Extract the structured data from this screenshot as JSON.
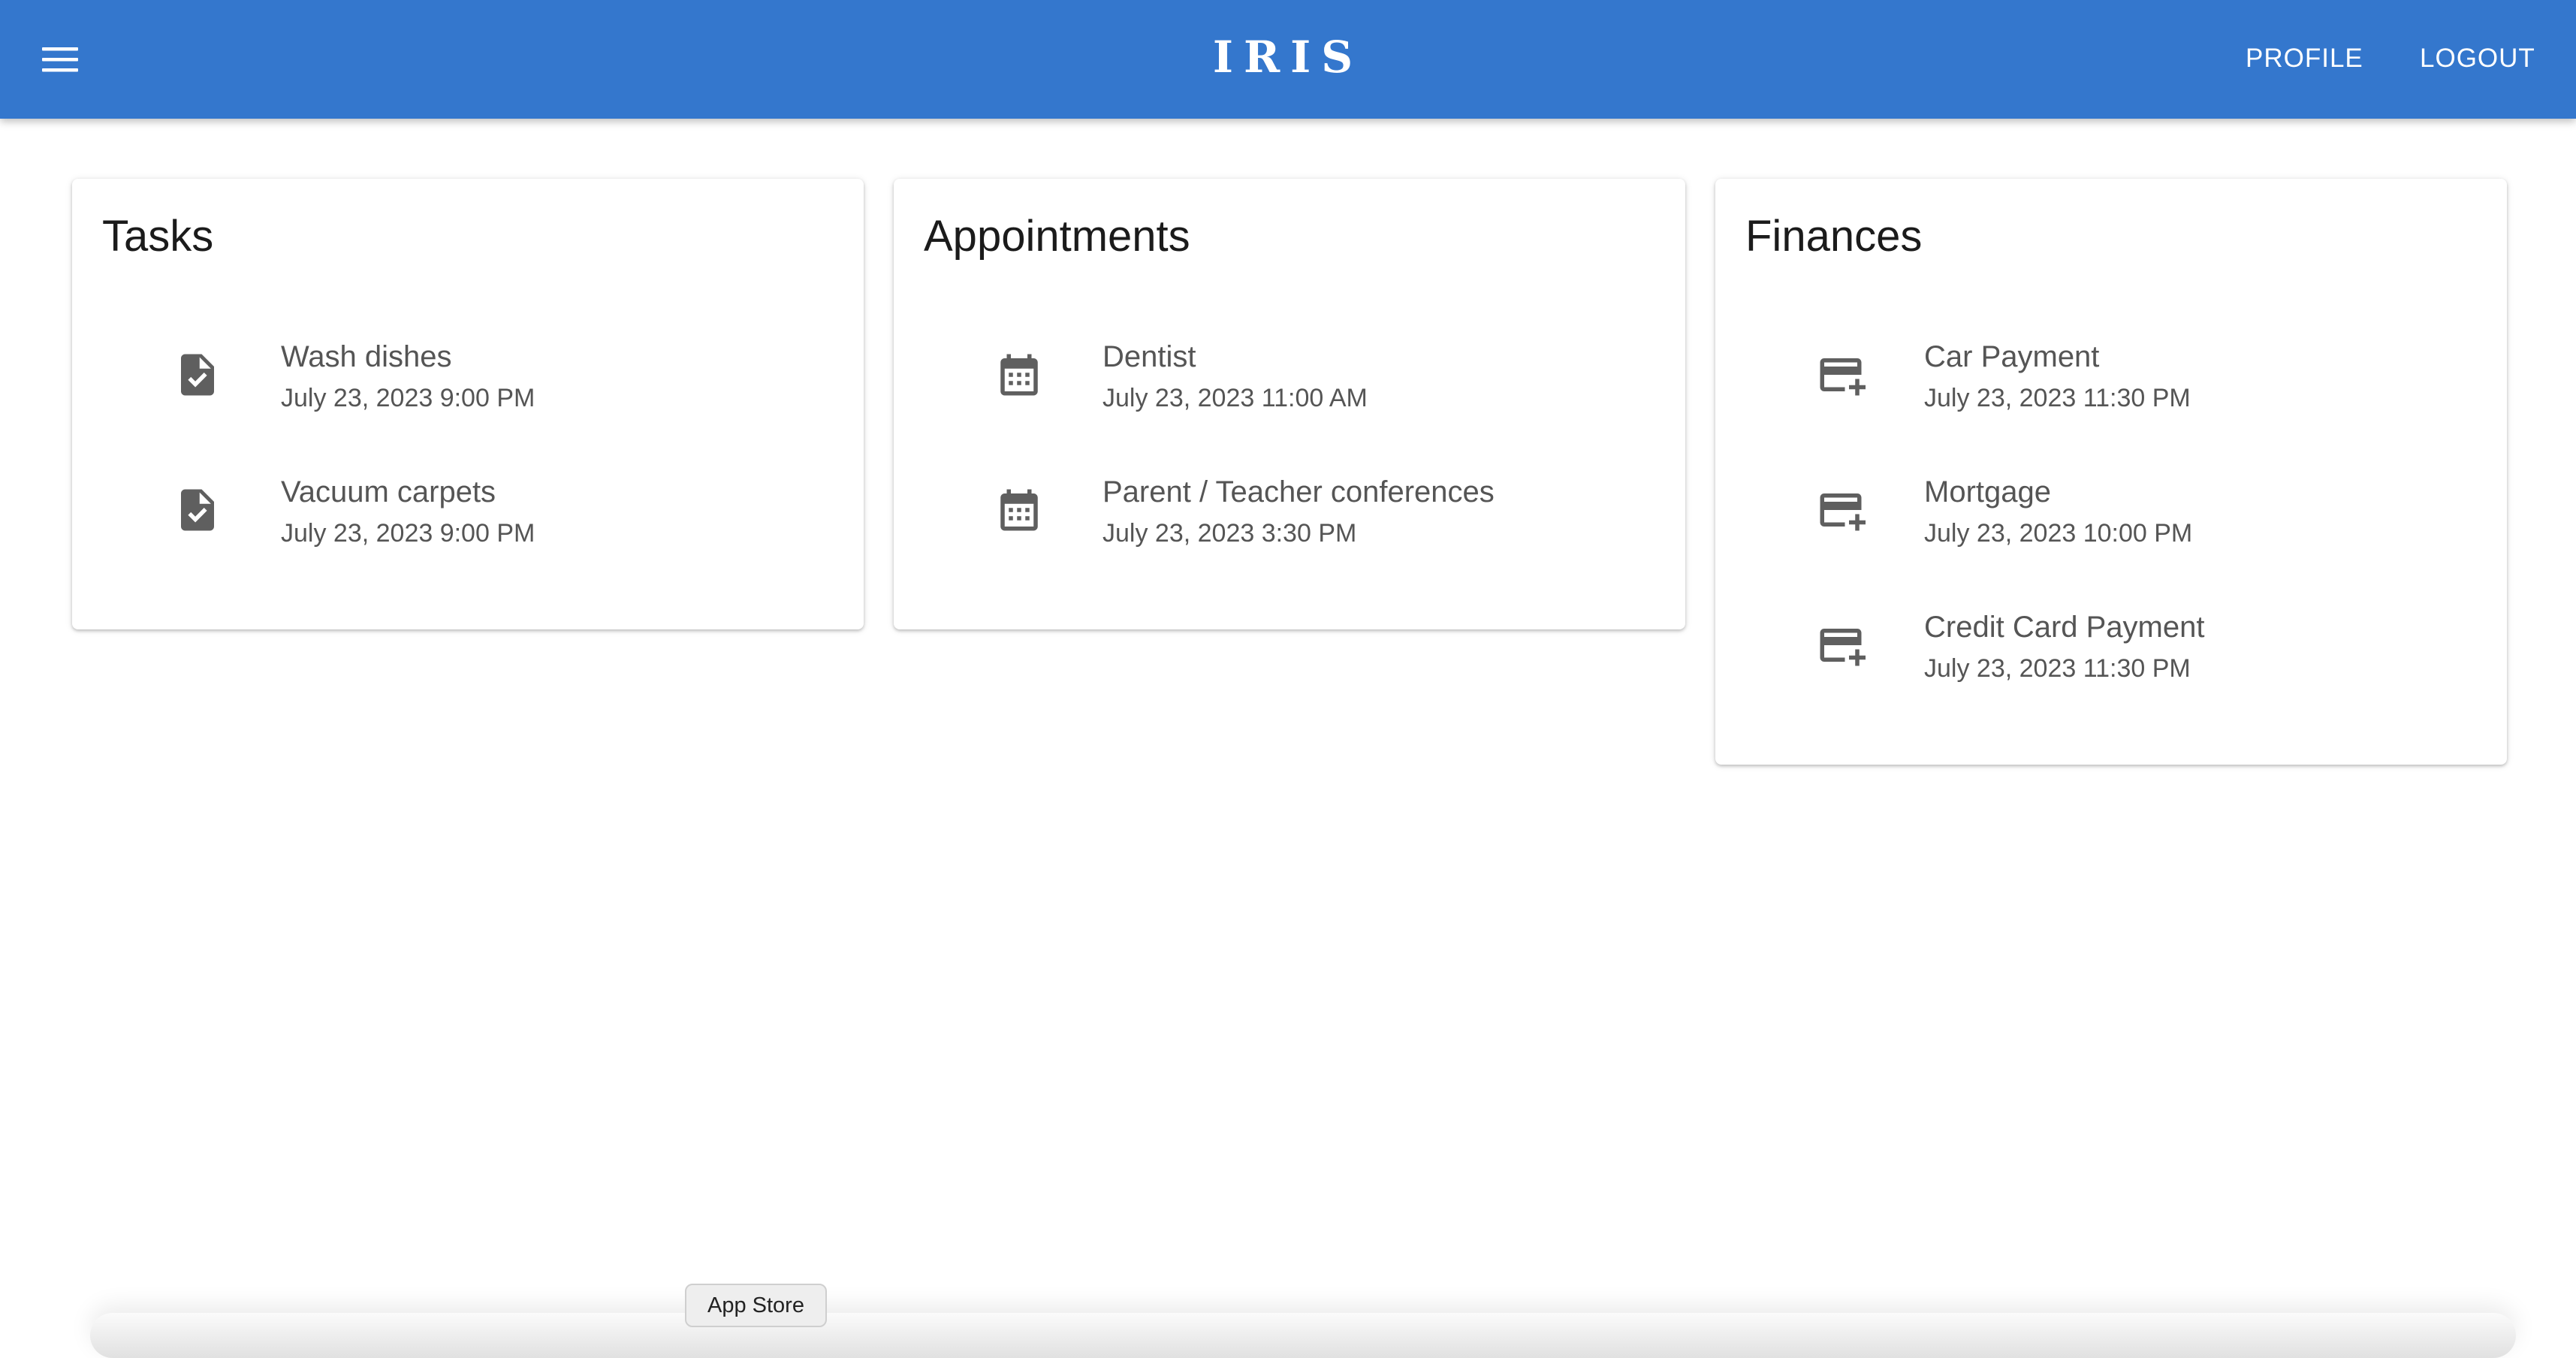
{
  "header": {
    "title": "IRIS",
    "menu_icon": "hamburger-menu-icon",
    "profile_label": "PROFILE",
    "logout_label": "LOGOUT",
    "color": "#3477cd"
  },
  "cards": {
    "tasks": {
      "title": "Tasks",
      "icon": "task-document-check-icon",
      "items": [
        {
          "title": "Wash dishes",
          "date": "July 23, 2023 9:00 PM"
        },
        {
          "title": "Vacuum carpets",
          "date": "July 23, 2023 9:00 PM"
        }
      ]
    },
    "appointments": {
      "title": "Appointments",
      "icon": "calendar-icon",
      "items": [
        {
          "title": "Dentist",
          "date": "July 23, 2023 11:00 AM"
        },
        {
          "title": "Parent / Teacher conferences",
          "date": "July 23, 2023 3:30 PM"
        }
      ]
    },
    "finances": {
      "title": "Finances",
      "icon": "add-card-icon",
      "items": [
        {
          "title": "Car Payment",
          "date": "July 23, 2023 11:30 PM"
        },
        {
          "title": "Mortgage",
          "date": "July 23, 2023 10:00 PM"
        },
        {
          "title": "Credit Card Payment",
          "date": "July 23, 2023 11:30 PM"
        }
      ]
    }
  },
  "dock": {
    "tooltip": "App Store"
  }
}
